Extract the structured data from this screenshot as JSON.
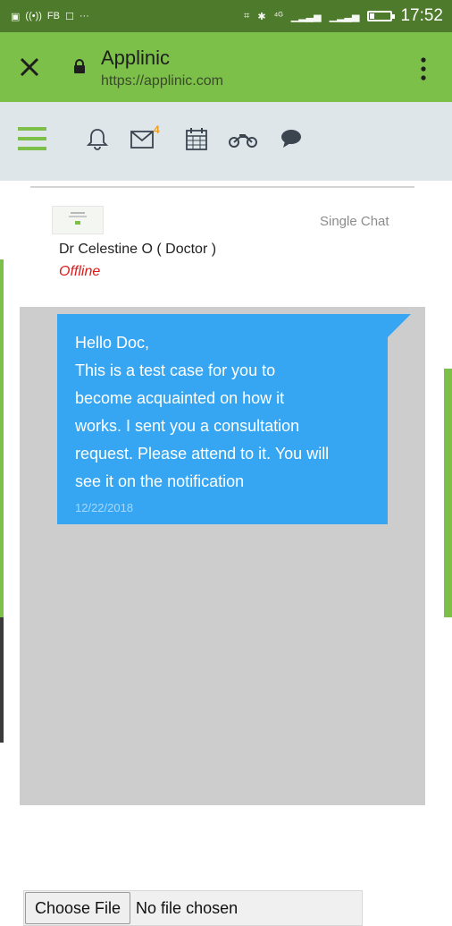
{
  "status_bar": {
    "left_glyphs": [
      "▣",
      "((•))",
      "FB",
      "☐",
      "···"
    ],
    "right_glyphs": [
      "⌗",
      "✱",
      "⁴ᴳ",
      "▁▂▃▅",
      "▁▂▃▅"
    ],
    "time": "17:52"
  },
  "browser": {
    "title": "Applinic",
    "url": "https://applinic.com",
    "icons": [
      "close-icon",
      "lock-icon",
      "more-vert-icon"
    ]
  },
  "app_nav": {
    "icons": [
      "hamburger-menu-icon",
      "bell-icon",
      "mail-icon",
      "calendar-icon",
      "motorcycle-icon",
      "chat-bubble-icon"
    ],
    "mail_badge": "4",
    "accent_color": "#7cc04a"
  },
  "chat": {
    "type_label": "Single Chat",
    "contact_name": "Dr Celestine O ( Doctor )",
    "contact_status": "Offline",
    "messages": [
      {
        "lines": [
          "Hello Doc,",
          "This is a test case for you to",
          "become acquainted on how it",
          "works. I sent you a consultation",
          "request. Please attend to it. You will",
          "see it on the notification"
        ],
        "date": "12/22/2018"
      }
    ],
    "file_input": {
      "button_label": "Choose File",
      "status": "No file chosen"
    }
  },
  "colors": {
    "status_bar": "#4e7a2c",
    "url_bar": "#7cc04a",
    "nav_bar": "#dfe6ea",
    "bubble": "#36a6f2",
    "offline": "#d81c1c"
  }
}
